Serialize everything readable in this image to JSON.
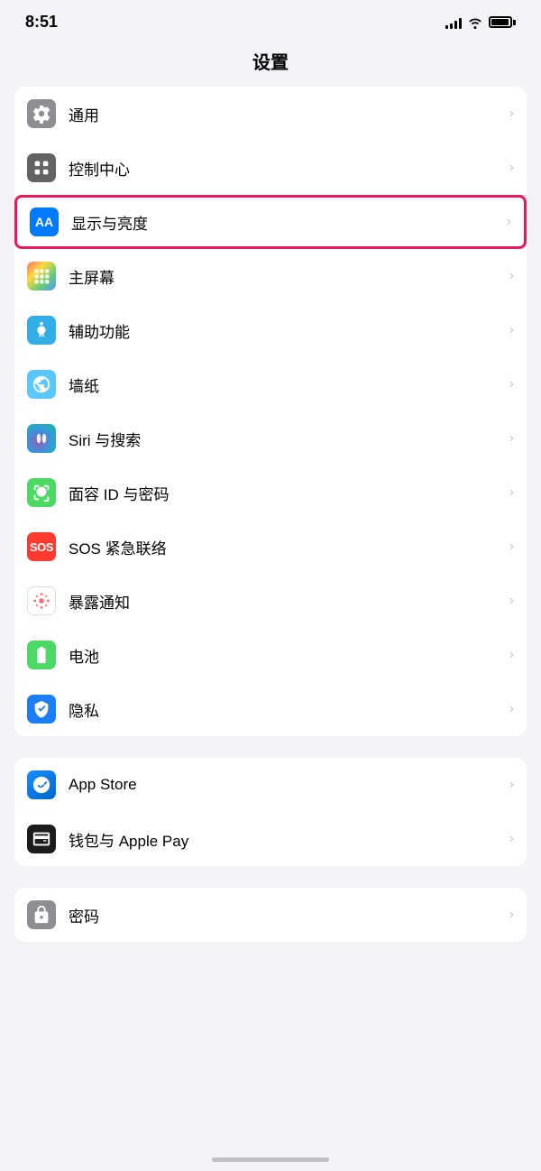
{
  "statusBar": {
    "time": "8:51"
  },
  "pageTitle": "设置",
  "sections": [
    {
      "id": "general",
      "rows": [
        {
          "id": "general",
          "label": "通用",
          "iconType": "gear",
          "iconBg": "gray",
          "highlighted": false
        },
        {
          "id": "control",
          "label": "控制中心",
          "iconType": "toggle",
          "iconBg": "gray2",
          "highlighted": false
        },
        {
          "id": "display",
          "label": "显示与亮度",
          "iconType": "aa",
          "iconBg": "blue",
          "highlighted": true
        },
        {
          "id": "homescreen",
          "label": "主屏幕",
          "iconType": "grid",
          "iconBg": "multicolor",
          "highlighted": false
        },
        {
          "id": "accessibility",
          "label": "辅助功能",
          "iconType": "accessibility",
          "iconBg": "lightblue",
          "highlighted": false
        },
        {
          "id": "wallpaper",
          "label": "墙纸",
          "iconType": "flower",
          "iconBg": "flower",
          "highlighted": false
        },
        {
          "id": "siri",
          "label": "Siri 与搜索",
          "iconType": "siri",
          "iconBg": "siri",
          "highlighted": false
        },
        {
          "id": "faceid",
          "label": "面容 ID 与密码",
          "iconType": "faceid",
          "iconBg": "faceid",
          "highlighted": false
        },
        {
          "id": "sos",
          "label": "SOS 紧急联络",
          "iconType": "sos",
          "iconBg": "sos",
          "highlighted": false
        },
        {
          "id": "exposure",
          "label": "暴露通知",
          "iconType": "exposure",
          "iconBg": "exposure",
          "highlighted": false
        },
        {
          "id": "battery",
          "label": "电池",
          "iconType": "battery",
          "iconBg": "battery",
          "highlighted": false
        },
        {
          "id": "privacy",
          "label": "隐私",
          "iconType": "privacy",
          "iconBg": "privacy",
          "highlighted": false
        }
      ]
    },
    {
      "id": "store",
      "rows": [
        {
          "id": "appstore",
          "label": "App Store",
          "iconType": "appstore",
          "iconBg": "appstore",
          "highlighted": false
        },
        {
          "id": "wallet",
          "label": "钱包与 Apple Pay",
          "iconType": "wallet",
          "iconBg": "wallet",
          "highlighted": false
        }
      ]
    },
    {
      "id": "passwords",
      "rows": [
        {
          "id": "password",
          "label": "密码",
          "iconType": "password",
          "iconBg": "password",
          "highlighted": false
        }
      ]
    }
  ]
}
